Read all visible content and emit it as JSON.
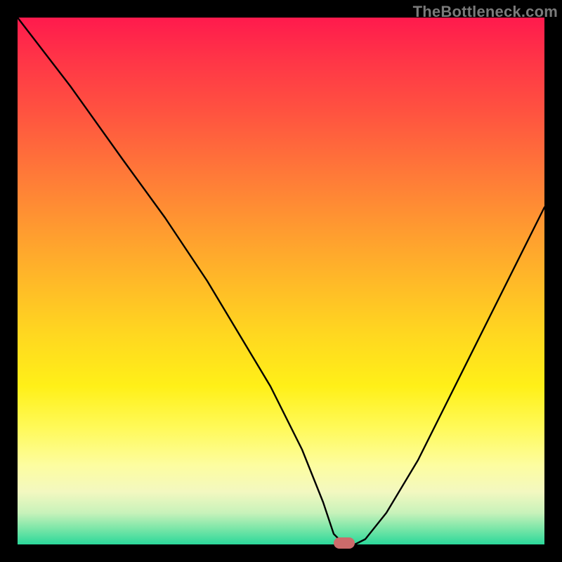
{
  "watermark": "TheBottleneck.com",
  "chart_data": {
    "type": "line",
    "title": "",
    "xlabel": "",
    "ylabel": "",
    "xlim": [
      0,
      100
    ],
    "ylim": [
      0,
      100
    ],
    "series": [
      {
        "name": "bottleneck-curve",
        "x": [
          0,
          10,
          20,
          28,
          36,
          42,
          48,
          54,
          58,
          60,
          62,
          64,
          66,
          70,
          76,
          82,
          88,
          94,
          100
        ],
        "values": [
          100,
          87,
          73,
          62,
          50,
          40,
          30,
          18,
          8,
          2,
          0,
          0,
          1,
          6,
          16,
          28,
          40,
          52,
          64
        ]
      }
    ],
    "marker": {
      "x_percent": 62,
      "y_percent": 0
    },
    "gradient_stops": [
      {
        "pct": 0,
        "color": "#ff1a4d"
      },
      {
        "pct": 50,
        "color": "#ffb928"
      },
      {
        "pct": 78,
        "color": "#fffa5a"
      },
      {
        "pct": 100,
        "color": "#2bd89a"
      }
    ]
  }
}
